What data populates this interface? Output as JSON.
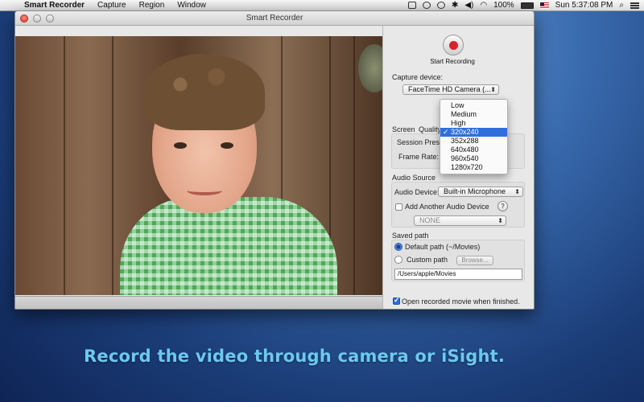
{
  "menubar": {
    "app": "Smart Recorder",
    "items": [
      "Capture",
      "Region",
      "Window"
    ],
    "battery": "100%",
    "clock": "Sun 5:37:08 PM"
  },
  "window": {
    "title": "Smart Recorder"
  },
  "panel": {
    "record_label": "Start Recording",
    "capture_device_label": "Capture device:",
    "capture_device_value": "FaceTime HD Camera (...",
    "tab_screen": "Screen",
    "tab_quality": "Quality",
    "session_preset_label": "Session Preset",
    "frame_rate_label": "Frame Rate:",
    "audio_source_label": "Audio Source",
    "audio_device_label": "Audio Device:",
    "audio_device_value": "Built-in Microphone",
    "add_audio_label": "Add Another Audio Device",
    "help": "?",
    "extra_audio_value": "NONE",
    "saved_path_label": "Saved path",
    "default_path_label": "Default path (~/Movies)",
    "custom_path_label": "Custom path",
    "browse_label": "Browse...",
    "path_value": "/Users/apple/Movies",
    "open_when_finished_label": "Open recorded movie when finished."
  },
  "preset_menu": {
    "options": [
      "Low",
      "Medium",
      "High",
      "320x240",
      "352x288",
      "640x480",
      "960x540",
      "1280x720"
    ],
    "selected": "320x240",
    "tick": "✓"
  },
  "caption": "Record the video through camera or iSight.",
  "colors": {
    "record_red": "#d8222a",
    "selection_blue": "#2f6fdb",
    "caption": "#6cc9f0"
  }
}
